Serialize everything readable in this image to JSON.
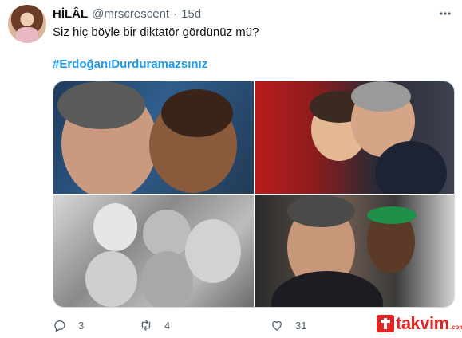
{
  "tweet": {
    "author_name": "HİLÂL",
    "handle": "@mrscrescent",
    "separator": "·",
    "time": "15d",
    "more_icon": "more-dots-icon",
    "text": "Siz hiç böyle bir diktatör gördünüz mü?",
    "hashtag": "#ErdoğanıDurduramazsınız"
  },
  "actions": {
    "reply_count": "3",
    "retweet_count": "4",
    "like_count": "31"
  },
  "watermark": {
    "brand": "takvim",
    "tld": ".com.tr"
  },
  "colors": {
    "link": "#1d9bf0",
    "secondary_text": "#536471",
    "watermark_red": "#e32424"
  }
}
